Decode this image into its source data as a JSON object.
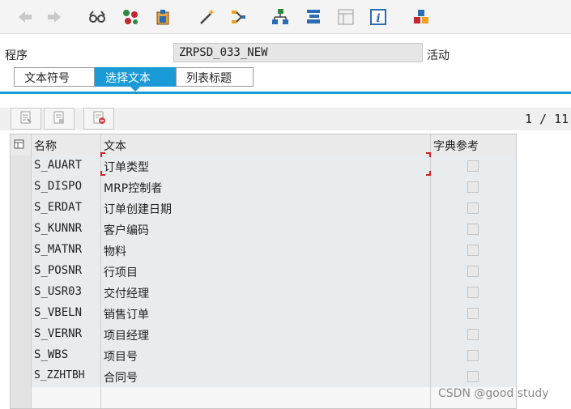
{
  "toolbar": {
    "icons": [
      "back-arrow-icon",
      "forward-arrow-icon",
      "glasses-display-icon",
      "object-list-icon",
      "clipboard-icon",
      "magic-wand-icon",
      "where-used-icon",
      "hierarchy-icon",
      "navigation-icon",
      "window-layout-icon",
      "info-icon",
      "stack-icon"
    ]
  },
  "program": {
    "label": "程序",
    "value": "ZRPSD_033_NEW",
    "status": "活动"
  },
  "tabs": [
    {
      "label": "文本符号",
      "active": false
    },
    {
      "label": "选择文本",
      "active": true
    },
    {
      "label": "列表标题",
      "active": false
    }
  ],
  "pager": "1 / 11",
  "table": {
    "headers": {
      "name": "名称",
      "text": "文本",
      "ref": "字典参考"
    },
    "rows": [
      {
        "name": "S_AUART",
        "text": "订单类型",
        "ref": false
      },
      {
        "name": "S_DISPO",
        "text": "MRP控制者",
        "ref": false
      },
      {
        "name": "S_ERDAT",
        "text": "订单创建日期",
        "ref": false
      },
      {
        "name": "S_KUNNR",
        "text": "客户编码",
        "ref": false
      },
      {
        "name": "S_MATNR",
        "text": "物料",
        "ref": false
      },
      {
        "name": "S_POSNR",
        "text": "行项目",
        "ref": false
      },
      {
        "name": "S_USR03",
        "text": "交付经理",
        "ref": false
      },
      {
        "name": "S_VBELN",
        "text": "销售订单",
        "ref": false
      },
      {
        "name": "S_VERNR",
        "text": "项目经理",
        "ref": false
      },
      {
        "name": "S_WBS",
        "text": "项目号",
        "ref": false
      },
      {
        "name": "S_ZZHTBH",
        "text": "合同号",
        "ref": false
      }
    ]
  },
  "watermark": "CSDN @good  study",
  "colors": {
    "accent": "#1a9ad6",
    "focus": "#d12020"
  }
}
